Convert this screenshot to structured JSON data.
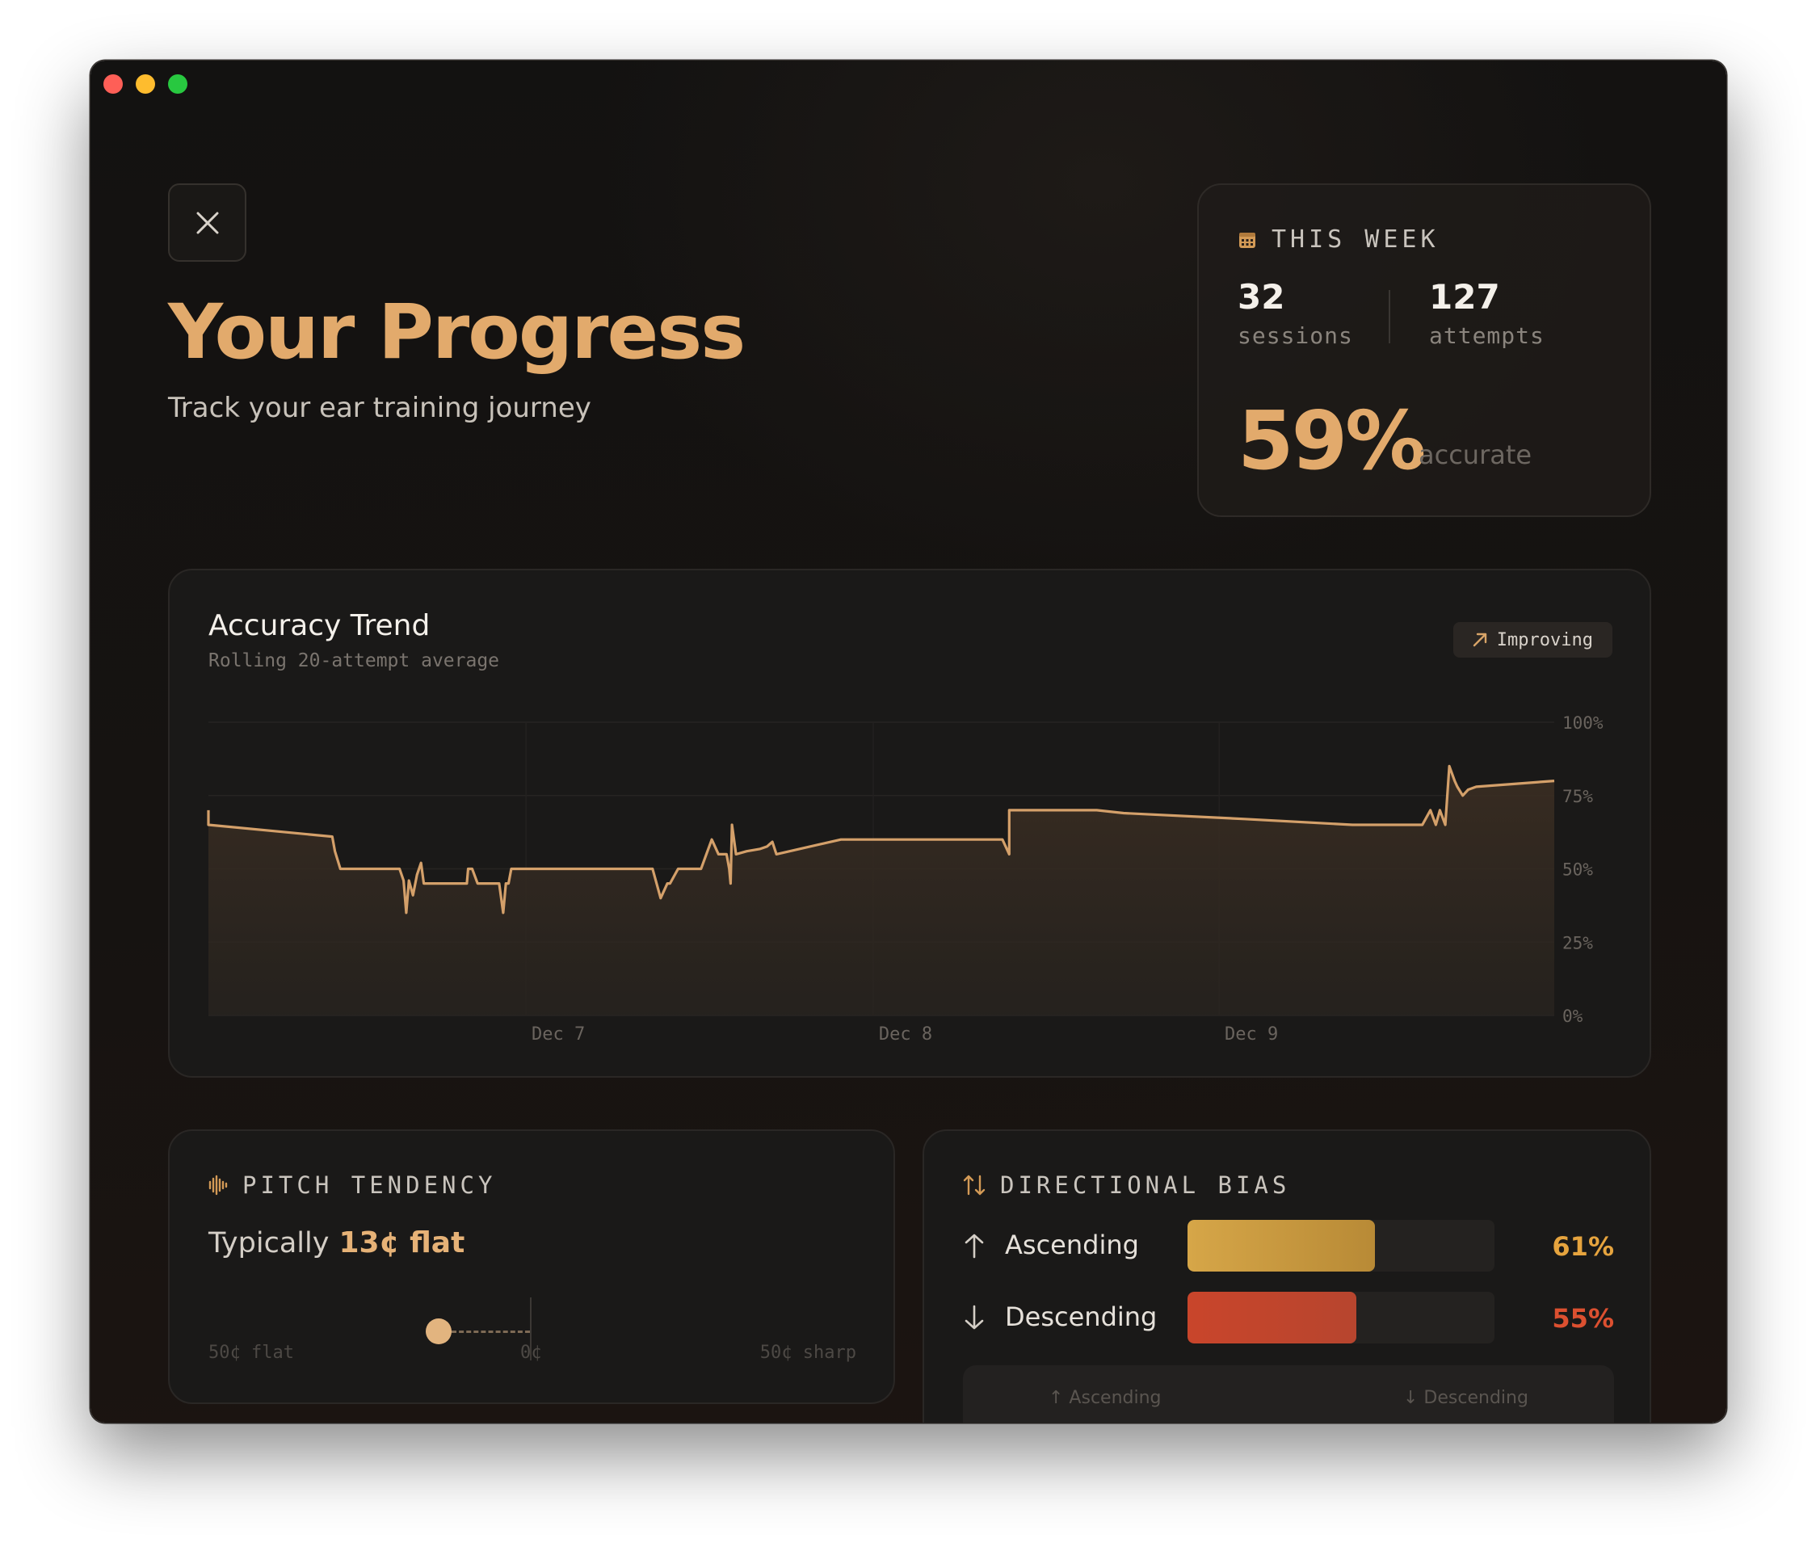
{
  "header": {
    "title": "Your Progress",
    "subtitle": "Track your ear training journey"
  },
  "this_week": {
    "label": "THIS WEEK",
    "sessions": "32",
    "sessions_label": "sessions",
    "attempts": "127",
    "attempts_label": "attempts",
    "accuracy": "59%",
    "accuracy_label": "accurate"
  },
  "trend": {
    "title": "Accuracy Trend",
    "subtitle": "Rolling 20-attempt average",
    "badge": "Improving"
  },
  "chart_data": {
    "type": "area",
    "title": "Accuracy Trend",
    "subtitle": "Rolling 20-attempt average",
    "xlabel": "",
    "ylabel": "",
    "ylim": [
      0,
      100
    ],
    "y_ticks": [
      "0%",
      "25%",
      "50%",
      "75%",
      "100%"
    ],
    "x_ticks": [
      "Dec 7",
      "Dec 8",
      "Dec 9"
    ],
    "x_tick_positions": [
      0.236,
      0.494,
      0.751
    ],
    "grid": true,
    "series": [
      {
        "x": [
          0.0,
          0.0,
          0.092,
          0.094,
          0.098,
          0.12,
          0.142,
          0.145,
          0.147,
          0.149,
          0.152,
          0.155,
          0.158,
          0.16,
          0.162,
          0.164,
          0.167,
          0.175,
          0.192,
          0.193,
          0.196,
          0.2,
          0.203,
          0.206,
          0.216,
          0.219,
          0.221,
          0.223,
          0.225,
          0.232,
          0.24,
          0.33,
          0.336,
          0.341,
          0.343,
          0.349,
          0.366,
          0.37,
          0.374,
          0.379,
          0.385,
          0.387,
          0.388,
          0.389,
          0.392,
          0.4,
          0.41,
          0.415,
          0.417,
          0.419,
          0.422,
          0.47,
          0.59,
          0.595,
          0.595,
          0.6,
          0.66,
          0.68,
          0.77,
          0.85,
          0.856,
          0.902,
          0.908,
          0.912,
          0.915,
          0.919,
          0.922,
          0.926,
          0.928,
          0.932,
          0.936,
          0.942,
          1.0
        ],
        "y": [
          70,
          65,
          61,
          56,
          50,
          50,
          50,
          46,
          35,
          46,
          41,
          48,
          52,
          45,
          45,
          45,
          45,
          45,
          45,
          50,
          50,
          45,
          45,
          45,
          45,
          35,
          45,
          45,
          50,
          50,
          50,
          50,
          40,
          45,
          45,
          50,
          50,
          55,
          60,
          55,
          55,
          50,
          45,
          65,
          55,
          56,
          56.8,
          57.6,
          58.4,
          59.2,
          55,
          60,
          60,
          55,
          70,
          70,
          70,
          69,
          67,
          65,
          65,
          65,
          70,
          65,
          70,
          65,
          85,
          80,
          78,
          75,
          77,
          78,
          80
        ]
      }
    ]
  },
  "pitch": {
    "label": "PITCH TENDENCY",
    "typically": "Typically",
    "value": "13¢ flat",
    "scale_left": "50¢ flat",
    "scale_center": "0¢",
    "scale_right": "50¢ sharp",
    "offset_cents": -13
  },
  "bias": {
    "label": "DIRECTIONAL BIAS",
    "ascending_label": "Ascending",
    "ascending_pct": "61%",
    "ascending_value": 0.61,
    "descending_label": "Descending",
    "descending_pct": "55%",
    "descending_value": 0.55,
    "sub_left": "↑ Ascending",
    "sub_right": "↓ Descending"
  },
  "colors": {
    "accent": "#e2aa6c",
    "ascending": "#d6a648",
    "descending": "#c9452b"
  }
}
